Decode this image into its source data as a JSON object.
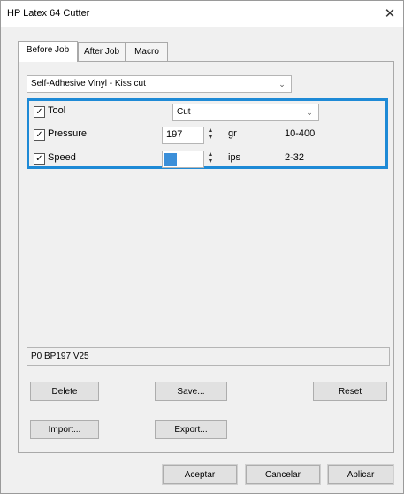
{
  "window": {
    "title": "HP Latex 64 Cutter",
    "close_glyph": "✕"
  },
  "tabs": [
    {
      "label": "Before Job",
      "active": true
    },
    {
      "label": "After Job",
      "active": false
    },
    {
      "label": "Macro",
      "active": false
    }
  ],
  "preset": {
    "value": "Self-Adhesive Vinyl - Kiss cut"
  },
  "params": {
    "tool": {
      "label": "Tool",
      "checked": true,
      "value": "Cut"
    },
    "pressure": {
      "label": "Pressure",
      "checked": true,
      "value": "197",
      "unit": "gr",
      "range": "10-400"
    },
    "speed": {
      "label": "Speed",
      "checked": true,
      "value": "",
      "unit": "ips",
      "range": "2-32"
    }
  },
  "status": {
    "text": "P0 BP197 V25"
  },
  "buttons": {
    "delete": "Delete",
    "save": "Save...",
    "reset": "Reset",
    "import": "Import...",
    "export": "Export...",
    "accept": "Aceptar",
    "cancel": "Cancelar",
    "apply": "Aplicar"
  },
  "icons": {
    "check": "☑",
    "dropdown": "chevron-down-icon",
    "spinner": "spinner-icon",
    "close": "close-icon"
  },
  "colors": {
    "highlight": "#1e8ad6",
    "selection": "#3b8fd9"
  }
}
